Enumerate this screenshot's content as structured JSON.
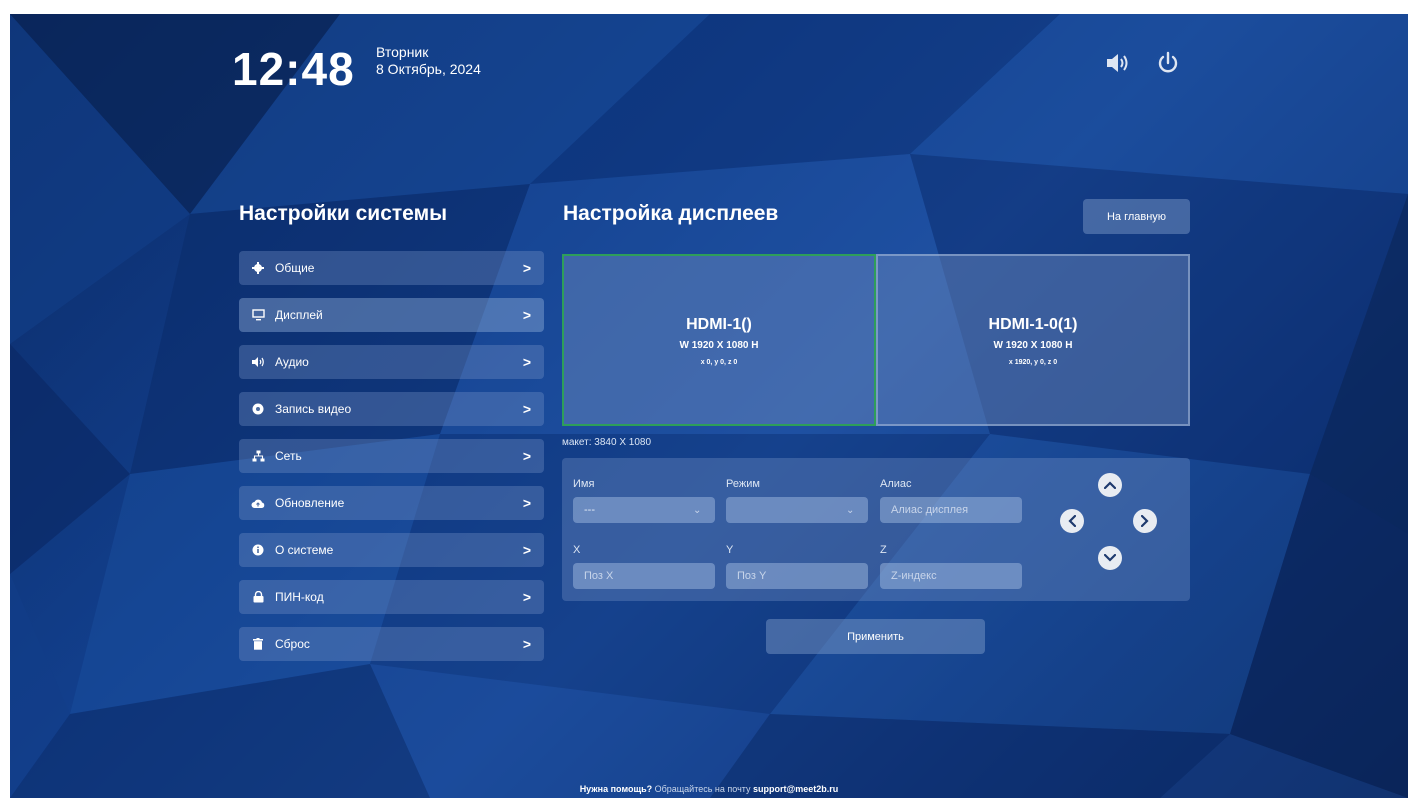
{
  "header": {
    "time": "12:48",
    "weekday": "Вторник",
    "date": "8 Октябрь, 2024",
    "icons": [
      "volume-icon",
      "power-icon"
    ]
  },
  "sidebar": {
    "title": "Настройки системы",
    "items": [
      {
        "label": "Общие",
        "icon": "gear-icon"
      },
      {
        "label": "Дисплей",
        "icon": "monitor-icon",
        "active": true
      },
      {
        "label": "Аудио",
        "icon": "speaker-icon"
      },
      {
        "label": "Запись видео",
        "icon": "record-icon"
      },
      {
        "label": "Сеть",
        "icon": "network-icon"
      },
      {
        "label": "Обновление",
        "icon": "cloud-upload-icon"
      },
      {
        "label": "О системе",
        "icon": "info-icon"
      },
      {
        "label": "ПИН-код",
        "icon": "lock-icon"
      },
      {
        "label": "Сброс",
        "icon": "trash-icon"
      }
    ]
  },
  "main": {
    "title": "Настройка дисплеев",
    "home_button": "На главную",
    "displays": [
      {
        "name": "HDMI-1()",
        "resolution": "W 1920 X 1080 H",
        "position": "x 0, y 0, z 0",
        "selected": true
      },
      {
        "name": "HDMI-1-0(1)",
        "resolution": "W 1920 X 1080 H",
        "position": "x 1920, y 0, z 0",
        "selected": false
      }
    ],
    "layout_size": "макет: 3840 X 1080",
    "form": {
      "name_label": "Имя",
      "name_value": "---",
      "mode_label": "Режим",
      "mode_value": "",
      "alias_label": "Алиас",
      "alias_placeholder": "Алиас дисплея",
      "x_label": "X",
      "x_placeholder": "Поз X",
      "y_label": "Y",
      "y_placeholder": "Поз Y",
      "z_label": "Z",
      "z_placeholder": "Z-индекс"
    },
    "apply_button": "Применить"
  },
  "footer": {
    "help_bold": "Нужна помощь?",
    "help_text": " Обращайтесь на почту ",
    "email": "support@meet2b.ru"
  },
  "colors": {
    "background_dark": "#0b2a66",
    "background_mid": "#1d4e9e",
    "selected_border": "#2e9e5a"
  }
}
